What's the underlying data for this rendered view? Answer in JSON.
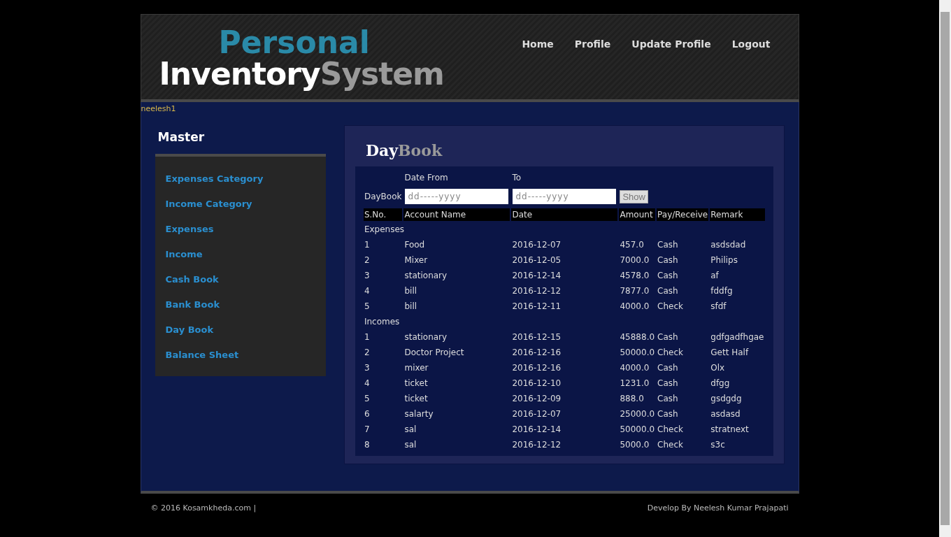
{
  "logo": {
    "top": "Personal",
    "main": "Inventory",
    "accent": "System"
  },
  "nav": [
    "Home",
    "Profile",
    "Update Profile",
    "Logout"
  ],
  "user": "neelesh1",
  "sidebar": {
    "title": "Master",
    "items": [
      "Expenses Category",
      "Income Category",
      "Expenses",
      "Income",
      "Cash Book",
      "Bank Book",
      "Day Book",
      "Balance Sheet"
    ]
  },
  "content": {
    "title": "Day",
    "title_accent": "Book",
    "filter": {
      "label": "DayBook",
      "from_label": "Date From",
      "to_label": "To",
      "from_placeholder": "dd-----yyyy",
      "to_placeholder": "dd-----yyyy",
      "button": "Show"
    },
    "columns": [
      "S.No.",
      "Account Name",
      "Date",
      "Amount",
      "Pay/Receive",
      "Remark"
    ],
    "sections": [
      {
        "title": "Expenses",
        "rows": [
          [
            "1",
            "Food",
            "2016-12-07",
            "457.0",
            "Cash",
            "asdsdad"
          ],
          [
            "2",
            "Mixer",
            "2016-12-05",
            "7000.0",
            "Cash",
            "Philips"
          ],
          [
            "3",
            "stationary",
            "2016-12-14",
            "4578.0",
            "Cash",
            "af"
          ],
          [
            "4",
            "bill",
            "2016-12-12",
            "7877.0",
            "Cash",
            "fddfg"
          ],
          [
            "5",
            "bill",
            "2016-12-11",
            "4000.0",
            "Check",
            "sfdf"
          ]
        ]
      },
      {
        "title": "Incomes",
        "rows": [
          [
            "1",
            "stationary",
            "2016-12-15",
            "45888.0",
            "Cash",
            "gdfgadfhgae"
          ],
          [
            "2",
            "Doctor Project",
            "2016-12-16",
            "50000.0",
            "Check",
            "Gett Half"
          ],
          [
            "3",
            "mixer",
            "2016-12-16",
            "4000.0",
            "Cash",
            "Olx"
          ],
          [
            "4",
            "ticket",
            "2016-12-10",
            "1231.0",
            "Cash",
            "dfgg"
          ],
          [
            "5",
            "ticket",
            "2016-12-09",
            "888.0",
            "Cash",
            "gsdgdg"
          ],
          [
            "6",
            "salarty",
            "2016-12-07",
            "25000.0",
            "Cash",
            "asdasd"
          ],
          [
            "7",
            "sal",
            "2016-12-14",
            "50000.0",
            "Check",
            "stratnext"
          ],
          [
            "8",
            "sal",
            "2016-12-12",
            "5000.0",
            "Check",
            "s3c"
          ]
        ]
      }
    ]
  },
  "footer": {
    "left": "© 2016 Kosamkheda.com |",
    "right": "Develop By Neelesh Kumar Prajapati"
  }
}
